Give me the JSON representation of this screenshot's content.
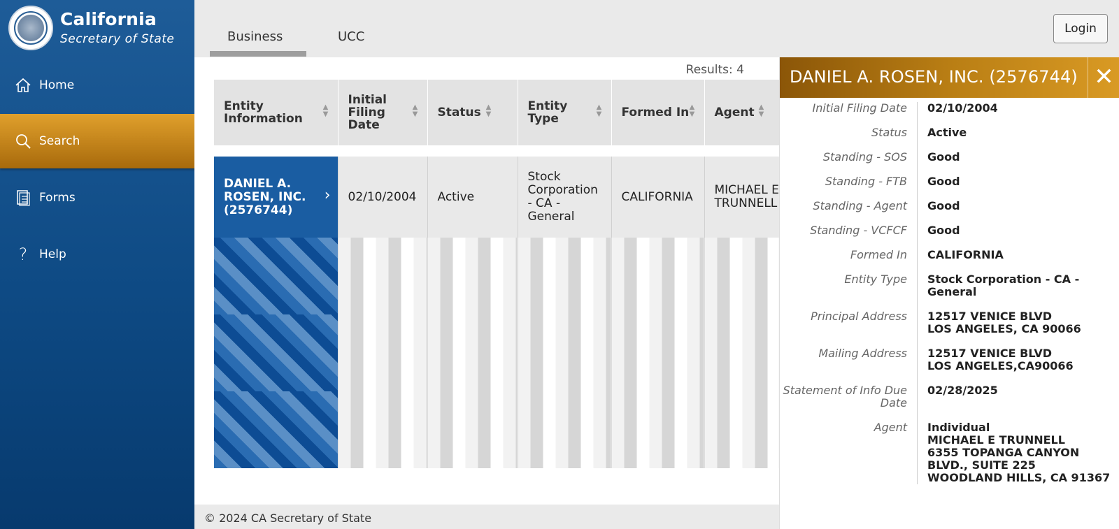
{
  "brand": {
    "title": "California",
    "subtitle": "Secretary of State"
  },
  "nav": {
    "home": "Home",
    "search": "Search",
    "forms": "Forms",
    "help": "Help"
  },
  "tabs": {
    "business": "Business",
    "ucc": "UCC"
  },
  "login": "Login",
  "results": "Results: 4",
  "table": {
    "headers": [
      "Entity Information",
      "Initial Filing Date",
      "Status",
      "Entity Type",
      "Formed In",
      "Agent"
    ],
    "row": {
      "entity": "DANIEL A. ROSEN, INC. (2576744)",
      "filing_date": "02/10/2004",
      "status": "Active",
      "entity_type": "Stock Corporation - CA - General",
      "formed_in": "CALIFORNIA",
      "agent": "MICHAEL E TRUNNELL"
    }
  },
  "footer": "© 2024 CA Secretary of State",
  "panel": {
    "title": "DANIEL A. ROSEN, INC. (2576744)",
    "fields": [
      {
        "label": "Initial Filing Date",
        "value": "02/10/2004"
      },
      {
        "label": "Status",
        "value": "Active"
      },
      {
        "label": "Standing - SOS",
        "value": "Good"
      },
      {
        "label": "Standing - FTB",
        "value": "Good"
      },
      {
        "label": "Standing - Agent",
        "value": "Good"
      },
      {
        "label": "Standing - VCFCF",
        "value": "Good"
      },
      {
        "label": "Formed In",
        "value": "CALIFORNIA"
      },
      {
        "label": "Entity Type",
        "value": "Stock Corporation - CA - General"
      },
      {
        "label": "Principal Address",
        "value": "12517 VENICE BLVD\nLOS ANGELES, CA 90066"
      },
      {
        "label": "Mailing Address",
        "value": "12517 VENICE BLVD\nLOS ANGELES,CA90066"
      },
      {
        "label": "Statement of Info Due Date",
        "value": "02/28/2025"
      },
      {
        "label": "Agent",
        "value": "Individual\nMICHAEL E TRUNNELL\n6355 TOPANGA CANYON BLVD., SUITE 225\nWOODLAND HILLS, CA  91367"
      }
    ]
  },
  "colors": {
    "sidebar": "#0e4a84",
    "accent": "#c48418",
    "selected_row": "#1a5da2"
  }
}
